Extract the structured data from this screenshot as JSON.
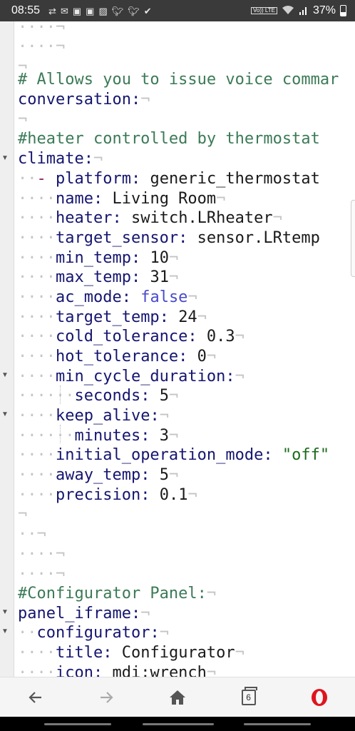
{
  "status_bar": {
    "time": "08:55",
    "notification_icons": [
      "sync-icon",
      "mail-icon",
      "gmail-icon",
      "gmail-icon",
      "image-icon",
      "twitter-icon",
      "twitter-icon",
      "check-icon"
    ],
    "volte": "Vo)) LTE",
    "battery": "37%"
  },
  "editor": {
    "colors": {
      "comment": "#3b7a57",
      "key": "#151570",
      "boolean": "#4a4acc",
      "string": "#1a6b1a"
    },
    "lines": [
      {
        "indent": "····",
        "text": ""
      },
      {
        "indent": "",
        "text": ""
      },
      {
        "comment": "# Allows you to issue voice commar"
      },
      {
        "key": "conversation",
        "sep": ":"
      },
      {
        "indent": "",
        "text": ""
      },
      {
        "comment": "#heater controlled by thermostat"
      },
      {
        "key": "climate",
        "sep": ":"
      },
      {
        "dash": "-",
        "key": "platform",
        "sep": ": ",
        "value": "generic_thermostat"
      },
      {
        "key": "name",
        "sep": ": ",
        "value": "Living Room"
      },
      {
        "key": "heater",
        "sep": ": ",
        "value": "switch.LRheater"
      },
      {
        "key": "target_sensor",
        "sep": ": ",
        "value": "sensor.LRtemp"
      },
      {
        "key": "min_temp",
        "sep": ": ",
        "value": "10"
      },
      {
        "key": "max_temp",
        "sep": ": ",
        "value": "31"
      },
      {
        "key": "ac_mode",
        "sep": ": ",
        "value": "false"
      },
      {
        "key": "target_temp",
        "sep": ": ",
        "value": "24"
      },
      {
        "key": "cold_tolerance",
        "sep": ": ",
        "value": "0.3"
      },
      {
        "key": "hot_tolerance",
        "sep": ": ",
        "value": "0"
      },
      {
        "key": "min_cycle_duration",
        "sep": ":"
      },
      {
        "key": "seconds",
        "sep": ": ",
        "value": "5"
      },
      {
        "key": "keep_alive",
        "sep": ":"
      },
      {
        "key": "minutes",
        "sep": ": ",
        "value": "3"
      },
      {
        "key": "initial_operation_mode",
        "sep": ": ",
        "value": "\"off\""
      },
      {
        "key": "away_temp",
        "sep": ": ",
        "value": "5"
      },
      {
        "key": "precision",
        "sep": ": ",
        "value": "0.1"
      },
      {
        "indent": "",
        "text": ""
      },
      {
        "indent": "··",
        "text": ""
      },
      {
        "indent": "····",
        "text": ""
      },
      {
        "indent": "",
        "text": ""
      },
      {
        "comment": "#Configurator Panel:"
      },
      {
        "key": "panel_iframe",
        "sep": ":"
      },
      {
        "key": "configurator",
        "sep": ":"
      },
      {
        "key": "title",
        "sep": ": ",
        "value": "Configurator"
      },
      {
        "key": "icon",
        "sep": ": ",
        "value": "mdi:wrench"
      }
    ]
  },
  "browser_bar": {
    "back": "back-arrow-icon",
    "forward": "forward-arrow-icon",
    "home": "home-icon",
    "tab_count": "6",
    "menu": "opera-logo-icon"
  }
}
